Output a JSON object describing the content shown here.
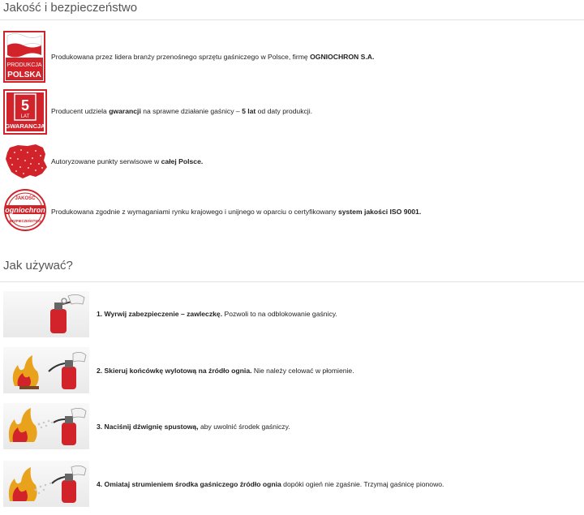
{
  "sections": {
    "quality_title": "Jakość i bezpieczeństwo",
    "usage_title": "Jak używać?"
  },
  "badges": {
    "produkcja_line1": "PRODUKCJA",
    "produkcja_line2": "POLSKA",
    "gwarancja_number": "5",
    "gwarancja_lat": "LAT",
    "gwarancja_word": "GWARANCJA",
    "seal_top": "JAKOŚĆ",
    "seal_brand": "ogniochron",
    "seal_bottom": "BEZPIECZEŃSTWO"
  },
  "quality_items": [
    {
      "pre": "Produkowana przez lidera branży przenośnego sprzętu gaśniczego w Polsce, firmę ",
      "bold": "OGNIOCHRON S.A.",
      "post": ""
    },
    {
      "pre": "Producent udziela ",
      "bold": "gwarancji",
      "mid": " na sprawne działanie gaśnicy – ",
      "bold2": "5 lat",
      "post": " od daty produkcji."
    },
    {
      "pre": "Autoryzowane punkty serwisowe w ",
      "bold": "całej Polsce.",
      "post": ""
    },
    {
      "pre": "Produkowana zgodnie z wymaganiami rynku krajowego i unijnego w oparciu o certyfikowany ",
      "bold": "system jakości ISO 9001.",
      "post": ""
    }
  ],
  "steps": [
    {
      "bold": "1. Wyrwij zabezpieczenie – zawleczkę.",
      "rest": " Pozwoli to na odblokowanie gaśnicy."
    },
    {
      "bold": "2. Skieruj końcówkę wylotową na źródło ognia.",
      "rest": " Nie należy celować w płomienie."
    },
    {
      "bold": "3. Naciśnij dźwignię spustową,",
      "rest": " aby uwolnić środek gaśniczy."
    },
    {
      "bold": "4. Omiataj strumieniem środka gaśniczego źródło ognia",
      "rest": " dopóki ogień nie zgaśnie. Trzymaj gaśnicę pionowo."
    }
  ],
  "colors": {
    "brand_red": "#d2232a",
    "heading_gray": "#555555"
  }
}
